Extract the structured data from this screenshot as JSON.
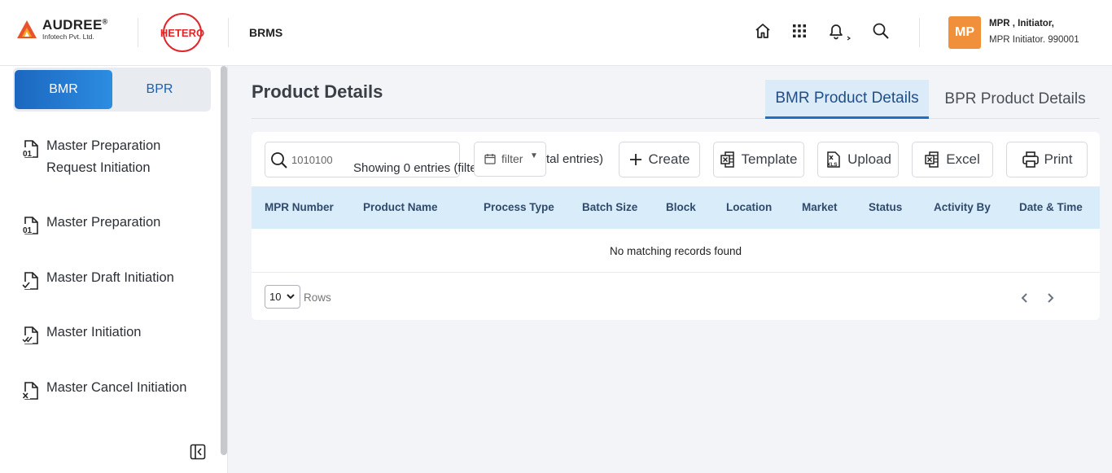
{
  "header": {
    "brand": {
      "name": "AUDREE",
      "registered": "®",
      "subtitle": "Infotech Pvt. Ltd."
    },
    "partner_logo": "HETERO",
    "app_title": "BRMS",
    "icons": [
      "home-icon",
      "apps-grid-icon",
      "bell-icon",
      "search-icon"
    ],
    "user": {
      "initials": "MP",
      "name": "MPR , Initiator,",
      "role": "MPR Initiator. 990001"
    }
  },
  "sidebar": {
    "toggle": {
      "active": "BMR",
      "inactive": "BPR"
    },
    "items": [
      {
        "label_line1": "Master Preparation",
        "label_line2": "Request Initiation",
        "icon": "binary-file-icon"
      },
      {
        "label_line1": "Master Preparation",
        "icon": "binary-file-icon"
      },
      {
        "label_line1": "Master Draft Initiation",
        "icon": "file-check-icon"
      },
      {
        "label_line1": "Master Initiation",
        "icon": "file-double-check-icon"
      },
      {
        "label_line1": "Master Cancel Initiation",
        "icon": "file-cancel-icon"
      }
    ]
  },
  "main": {
    "title": "Product Details",
    "tabs": [
      {
        "label": "BMR Product Details",
        "active": true
      },
      {
        "label": "BPR Product Details",
        "active": false
      }
    ],
    "toolbar": {
      "search_value": "1010100",
      "showing_text": "Showing 0 entries (filtere",
      "showing_tail": "tal entries)",
      "filter_label": "filter",
      "create_label": "Create",
      "template_label": "Template",
      "upload_label": "Upload",
      "excel_label": "Excel",
      "print_label": "Print"
    },
    "table": {
      "columns": [
        "MPR Number",
        "Product Name",
        "Process Type",
        "Batch Size",
        "Block",
        "Location",
        "Market",
        "Status",
        "Activity By",
        "Date & Time"
      ],
      "empty_message": "No matching records found"
    },
    "pagination": {
      "rows_per_page": "10",
      "rows_label": "Rows"
    }
  },
  "colors": {
    "accent": "#1f6fc4",
    "avatar": "#f0903b",
    "table_header": "#d9ecfa",
    "tab_active_bg": "#dcebf8"
  }
}
